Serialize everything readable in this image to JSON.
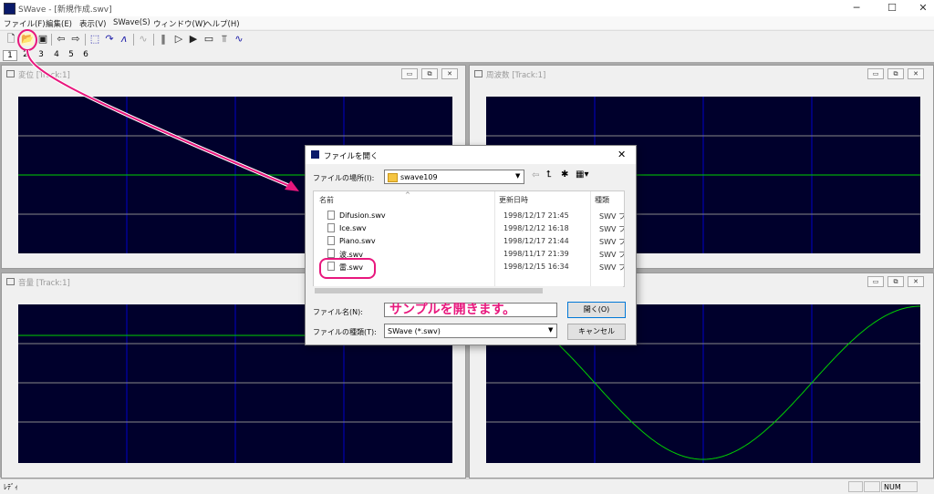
{
  "window": {
    "title": "SWave - [新規作成.swv]"
  },
  "menu": [
    "ファイル(F)",
    "編集(E)",
    "表示(V)",
    "SWave(S)",
    "ウィンドウ(W)",
    "ヘルプ(H)"
  ],
  "tabs": [
    "1",
    "2",
    "3",
    "4",
    "5",
    "6"
  ],
  "tracks": {
    "t1": {
      "title": "変位 [Track:1]"
    },
    "t2": {
      "title": "周波数 [Track:1]"
    },
    "t3": {
      "title": "音量 [Track:1]"
    }
  },
  "dialog": {
    "title": "ファイルを開く",
    "look_in_label": "ファイルの場所(I):",
    "look_in_value": "swave109",
    "col_name": "名前",
    "col_date": "更新日時",
    "col_type": "種類",
    "files": [
      {
        "name": "Difusion.swv",
        "date": "1998/12/17 21:45",
        "type": "SWV ファイル"
      },
      {
        "name": "Ice.swv",
        "date": "1998/12/12 16:18",
        "type": "SWV ファイル"
      },
      {
        "name": "Piano.swv",
        "date": "1998/12/17 21:44",
        "type": "SWV ファイル"
      },
      {
        "name": "波.swv",
        "date": "1998/11/17 21:39",
        "type": "SWV ファイル"
      },
      {
        "name": "雷.swv",
        "date": "1998/12/15 16:34",
        "type": "SWV ファイル"
      }
    ],
    "filename_label": "ファイル名(N):",
    "filename_value": "",
    "filetype_label": "ファイルの種類(T):",
    "filetype_value": "SWave (*.swv)",
    "open_button": "開く(O)",
    "cancel_button": "キャンセル"
  },
  "annotation": "サンプルを開きます。",
  "status": {
    "text": "ﾚﾃﾞｨ",
    "num": "NUM"
  },
  "colors": {
    "accent": "#e8177d",
    "plot_bg": "#00002c",
    "wave": "#00d000"
  }
}
